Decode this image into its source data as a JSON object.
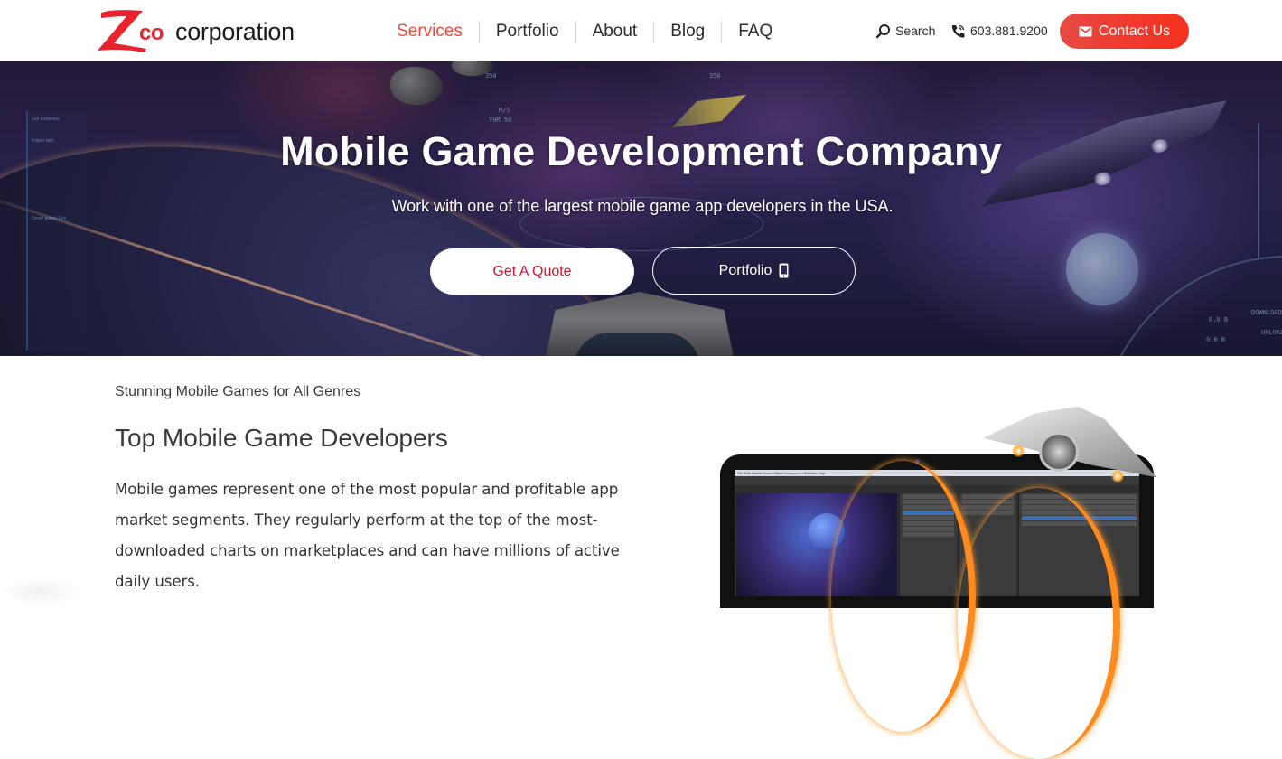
{
  "brand": {
    "logo_mark": "Z",
    "logo_co": "co",
    "logo_text": "corporation",
    "accent_color": "#e8232e"
  },
  "nav": {
    "items": [
      {
        "label": "Services",
        "active": true
      },
      {
        "label": "Portfolio",
        "active": false
      },
      {
        "label": "About",
        "active": false
      },
      {
        "label": "Blog",
        "active": false
      },
      {
        "label": "FAQ",
        "active": false
      }
    ],
    "active_color": "#ef4b3c"
  },
  "utility": {
    "search_label": "Search",
    "search_icon": "search-icon",
    "phone_number": "603.881.9200",
    "phone_icon": "phone-icon",
    "contact_label": "Contact Us",
    "contact_icon": "envelope-icon",
    "contact_color": "#f1382a"
  },
  "hero": {
    "title": "Mobile Game Development Company",
    "subtitle": "Work with one of the largest mobile game app developers in the USA.",
    "quote_button": "Get A Quote",
    "portfolio_button": "Portfolio",
    "portfolio_icon": "mobile-phone-icon",
    "hud": {
      "speed_label": "M/S",
      "thrust_label": "THR 50",
      "range_left": "350",
      "range_right": "350",
      "left_panel_1": "Lee Evidence",
      "left_panel_2": "Kuiper belt",
      "left_panel_3": "Dwarf planet Eris",
      "download_label": "DOWNLOAD",
      "upload_label": "UPLOAD",
      "download_value": "0.0 B",
      "upload_value": "0.0 B"
    }
  },
  "content": {
    "eyebrow": "Stunning Mobile Games for All Genres",
    "heading": "Top Mobile Game Developers",
    "paragraph": "Mobile games represent one of the most popular and profitable app market segments. They regularly perform at the top of the most-downloaded charts on marketplaces and can have millions of active daily users.",
    "illustration": {
      "menu": "File  Edit  Assets  GameObject  Component  Window  Help"
    }
  }
}
